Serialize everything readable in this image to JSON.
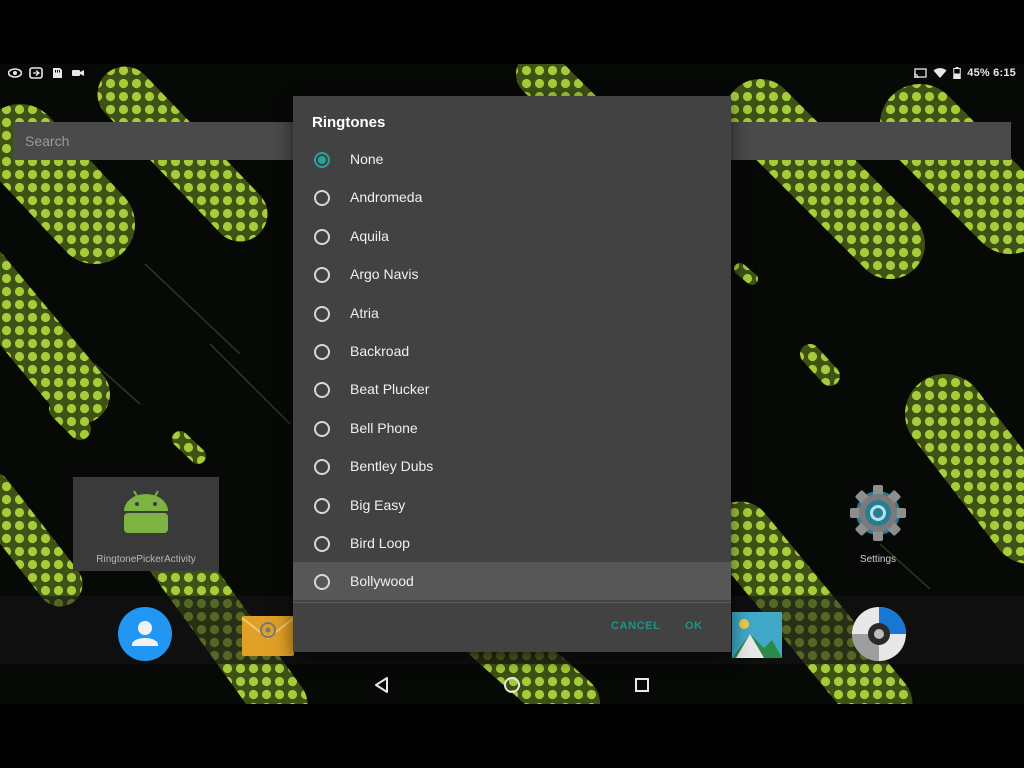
{
  "status_bar": {
    "left_icons": [
      "eye-icon",
      "cast-app-icon",
      "sd-card-icon",
      "video-camera-icon"
    ],
    "right_icons": [
      "cast-icon",
      "wifi-icon",
      "battery-icon"
    ],
    "text": "45% 6:15"
  },
  "launcher": {
    "search_placeholder": "Search",
    "app_tile_label": "RingtonePickerActivity",
    "settings_label": "Settings",
    "dock_icons": [
      "contacts-icon",
      "email-icon",
      "gallery-icon",
      "camera-icon"
    ]
  },
  "dialog": {
    "title": "Ringtones",
    "items": [
      {
        "label": "None",
        "checked": true
      },
      {
        "label": "Andromeda",
        "checked": false
      },
      {
        "label": "Aquila",
        "checked": false
      },
      {
        "label": "Argo Navis",
        "checked": false
      },
      {
        "label": "Atria",
        "checked": false
      },
      {
        "label": "Backroad",
        "checked": false
      },
      {
        "label": "Beat Plucker",
        "checked": false
      },
      {
        "label": "Bell Phone",
        "checked": false
      },
      {
        "label": "Bentley Dubs",
        "checked": false
      },
      {
        "label": "Big Easy",
        "checked": false
      },
      {
        "label": "Bird Loop",
        "checked": false
      },
      {
        "label": "Bollywood",
        "checked": false
      }
    ],
    "cancel_label": "CANCEL",
    "ok_label": "OK"
  },
  "navigation": [
    "back-icon",
    "home-icon",
    "recents-icon"
  ],
  "colors": {
    "accent": "#26a69a",
    "dialog_bg": "#424242",
    "wallpaper_green": "#a6cc3a"
  }
}
